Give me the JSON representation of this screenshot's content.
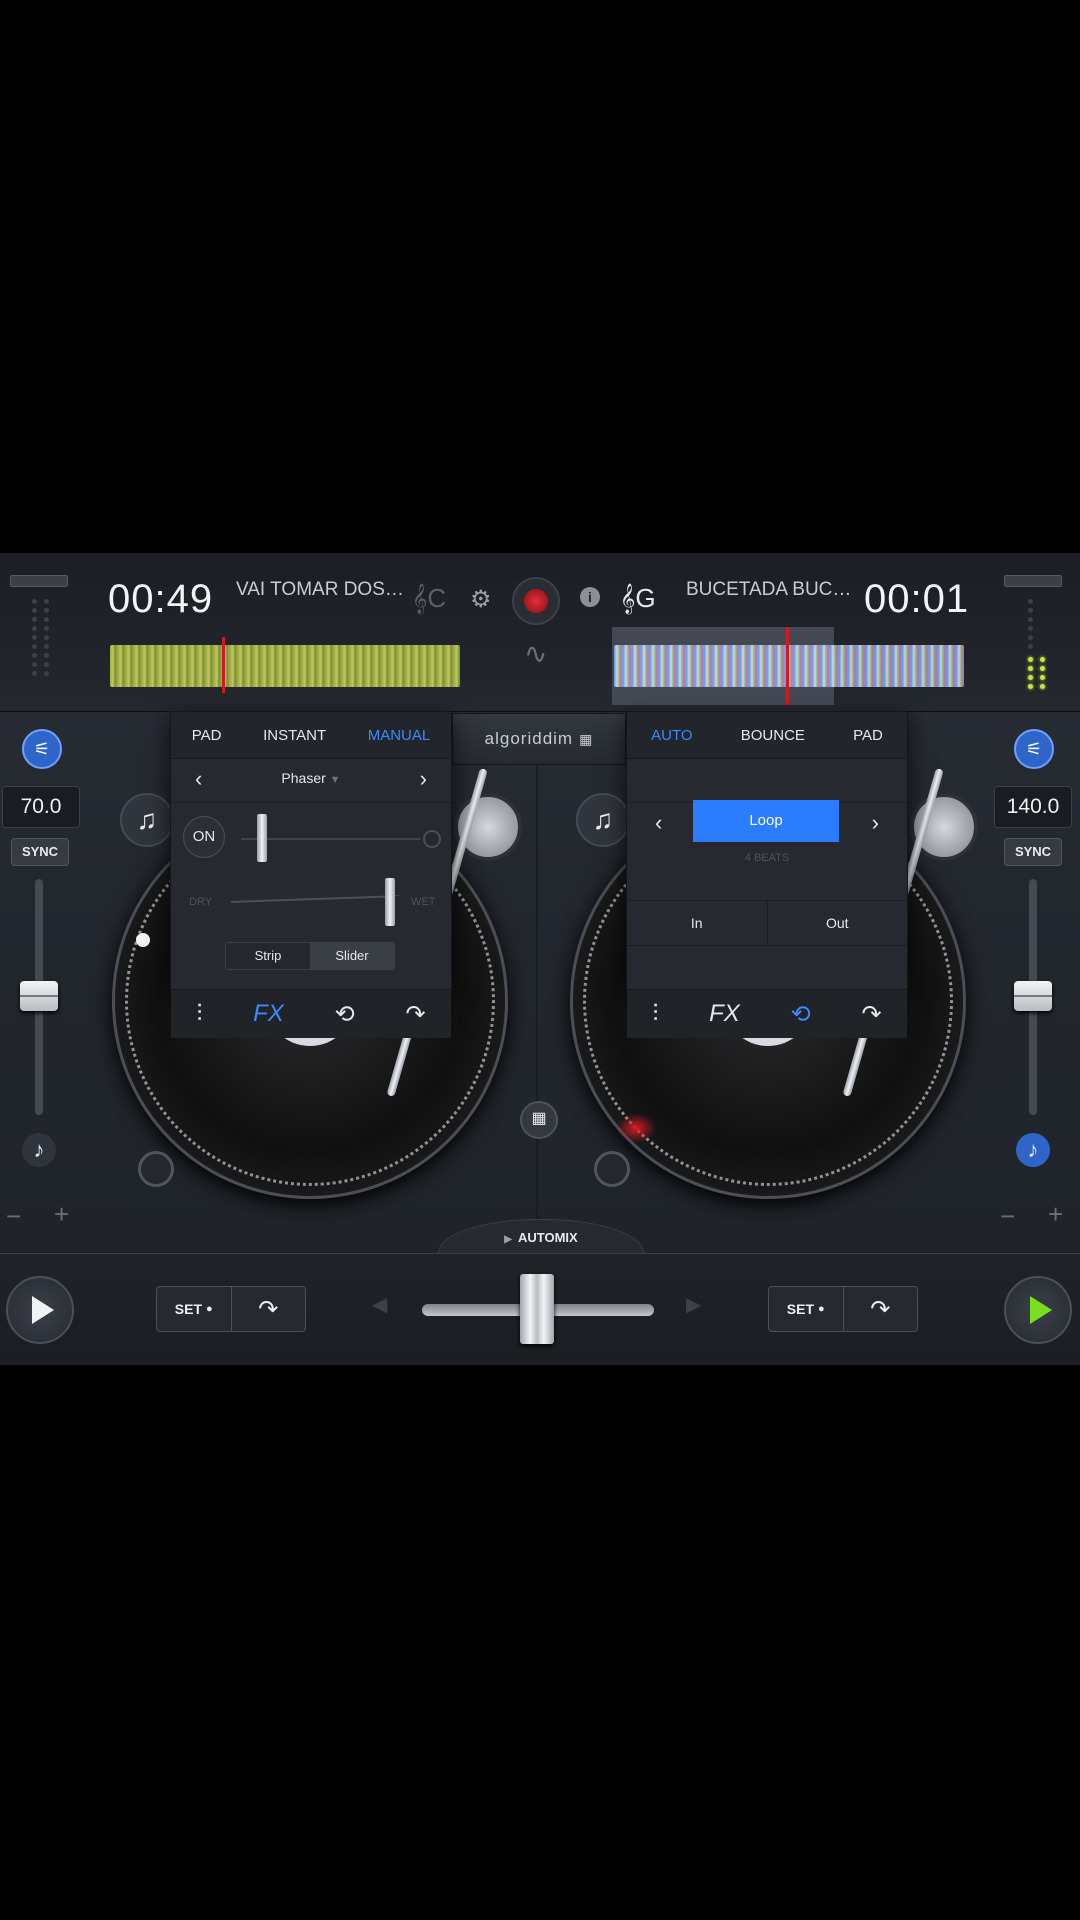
{
  "deck_left": {
    "time": "00:49",
    "track_title": "VAI TOMAR DOS…",
    "key": "C",
    "bpm": "70.0",
    "sync_label": "SYNC",
    "fx_panel": {
      "tabs": [
        "PAD",
        "INSTANT",
        "MANUAL"
      ],
      "active_tab": "MANUAL",
      "effect_name": "Phaser",
      "on_label": "ON",
      "dry_label": "DRY",
      "wet_label": "WET",
      "mode_options": [
        "Strip",
        "Slider"
      ],
      "selected_mode": "Slider",
      "bottom_icons": [
        "mixer-icon",
        "fx-icon",
        "loop-icon",
        "skip-icon"
      ],
      "active_icon": "fx-icon"
    },
    "cue_set_label": "SET"
  },
  "deck_right": {
    "time": "00:01",
    "track_title": "BUCETADA BUC…",
    "key": "G",
    "bpm": "140.0",
    "sync_label": "SYNC",
    "loop_panel": {
      "tabs": [
        "AUTO",
        "BOUNCE",
        "PAD"
      ],
      "active_tab": "AUTO",
      "loop_label": "Loop",
      "beats_label": "4 BEATS",
      "in_label": "In",
      "out_label": "Out",
      "bottom_icons": [
        "mixer-icon",
        "fx-icon",
        "loop-icon",
        "skip-icon"
      ],
      "active_icon": "loop-icon"
    },
    "cue_set_label": "SET"
  },
  "brand": "algoriddim",
  "automix_label": "AUTOMIX",
  "colors": {
    "accent_blue": "#3b8bff",
    "loop_active": "#2b7cff",
    "record_red": "#c0121a",
    "play_green": "#79e021"
  }
}
